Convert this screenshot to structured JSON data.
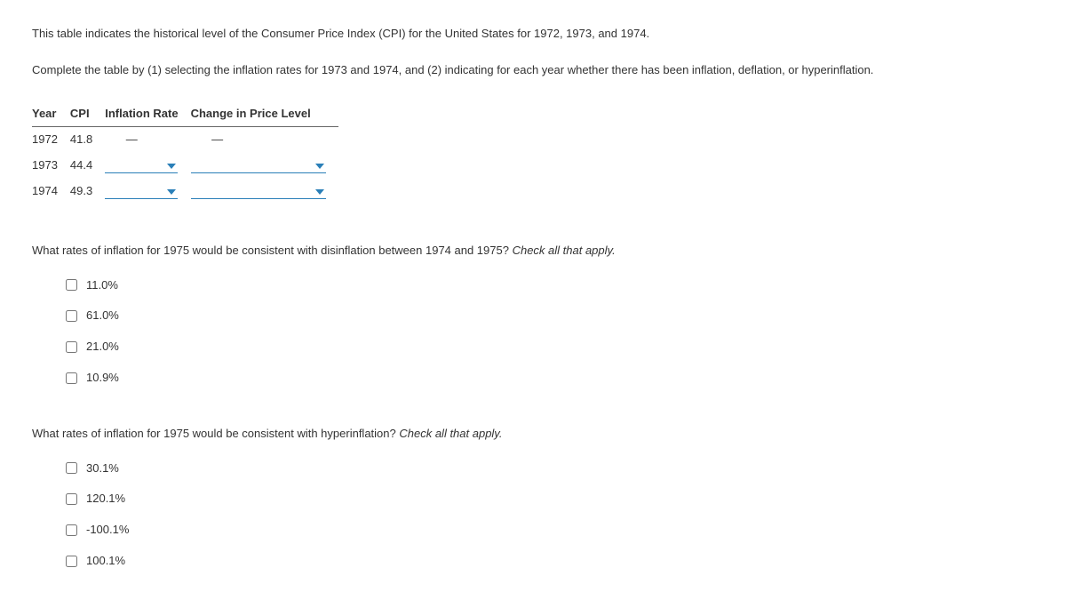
{
  "intro": {
    "p1": "This table indicates the historical level of the Consumer Price Index (CPI) for the United States for 1972, 1973, and 1974.",
    "p2": "Complete the table by (1) selecting the inflation rates for 1973 and 1974, and (2) indicating for each year whether there has been inflation, deflation, or hyperinflation."
  },
  "table": {
    "headers": {
      "year": "Year",
      "cpi": "CPI",
      "rate": "Inflation Rate",
      "change": "Change in Price Level"
    },
    "rows": [
      {
        "year": "1972",
        "cpi": "41.8",
        "rate_dash": "—",
        "change_dash": "—"
      },
      {
        "year": "1973",
        "cpi": "44.4"
      },
      {
        "year": "1974",
        "cpi": "49.3"
      }
    ]
  },
  "q1": {
    "prompt_main": "What rates of inflation for 1975 would be consistent with disinflation between 1974 and 1975? ",
    "prompt_hint": "Check all that apply.",
    "options": [
      "11.0%",
      "61.0%",
      "21.0%",
      "10.9%"
    ]
  },
  "q2": {
    "prompt_main": "What rates of inflation for 1975 would be consistent with hyperinflation? ",
    "prompt_hint": "Check all that apply.",
    "options": [
      "30.1%",
      "120.1%",
      "-100.1%",
      "100.1%"
    ]
  }
}
